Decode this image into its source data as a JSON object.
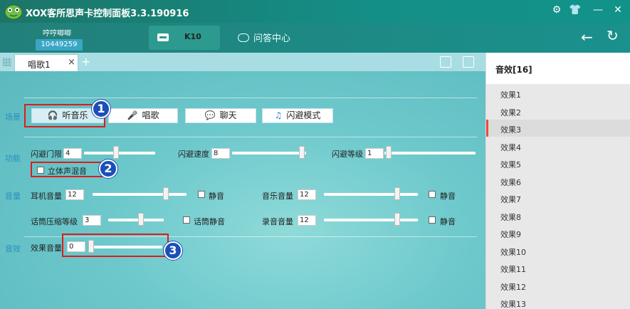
{
  "window": {
    "title": "XOX客所思声卡控制面板3.3.190916"
  },
  "header": {
    "user_name": "哼哼唧唧",
    "user_id": "10449259",
    "device_label": "K10",
    "qa_label": "问答中心"
  },
  "tabs": {
    "active_label": "唱歌1",
    "close": "×",
    "add": "+"
  },
  "sections": {
    "scene": "场景",
    "function": "功能",
    "volume": "音量",
    "effect": "音效"
  },
  "modes": [
    {
      "label": "听音乐",
      "icon": "headphones-icon",
      "active": true
    },
    {
      "label": "唱歌",
      "icon": "microphone-icon",
      "active": false
    },
    {
      "label": "聊天",
      "icon": "chat-bubble-icon",
      "active": false
    },
    {
      "label": "闪避模式",
      "icon": "music-note-icon",
      "active": false
    }
  ],
  "function": {
    "dodge_threshold": {
      "label": "闪避门限",
      "value": "4",
      "level": 0.45
    },
    "dodge_speed": {
      "label": "闪避速度",
      "value": "8",
      "level": 0.98
    },
    "dodge_level": {
      "label": "闪避等级",
      "value": "1",
      "level": 0.02
    },
    "stereo_mix": {
      "label": "立体声混音",
      "checked": false
    }
  },
  "volume": {
    "headphone": {
      "label": "耳机音量",
      "value": "12",
      "level": 0.8,
      "mute_label": "静音"
    },
    "music": {
      "label": "音乐音量",
      "value": "12",
      "level": 0.8,
      "mute_label": "静音"
    },
    "mic_compress": {
      "label": "话筒压缩等级",
      "value": "3",
      "level": 0.6,
      "mute_label": "话筒静音"
    },
    "record": {
      "label": "录音音量",
      "value": "12",
      "level": 0.8,
      "mute_label": "静音"
    }
  },
  "effect": {
    "label": "效果音量",
    "value": "0",
    "level": 0.0
  },
  "annotations": [
    "1",
    "2",
    "3"
  ],
  "right_panel": {
    "title": "音效[16]",
    "items": [
      "效果1",
      "效果2",
      "效果3",
      "效果4",
      "效果5",
      "效果6",
      "效果7",
      "效果8",
      "效果9",
      "效果10",
      "效果11",
      "效果12",
      "效果13"
    ],
    "selected": "效果3"
  },
  "colors": {
    "accent_red": "#e01b1b",
    "badge_blue": "#1b4fb8",
    "titlebar": "#148f87"
  }
}
